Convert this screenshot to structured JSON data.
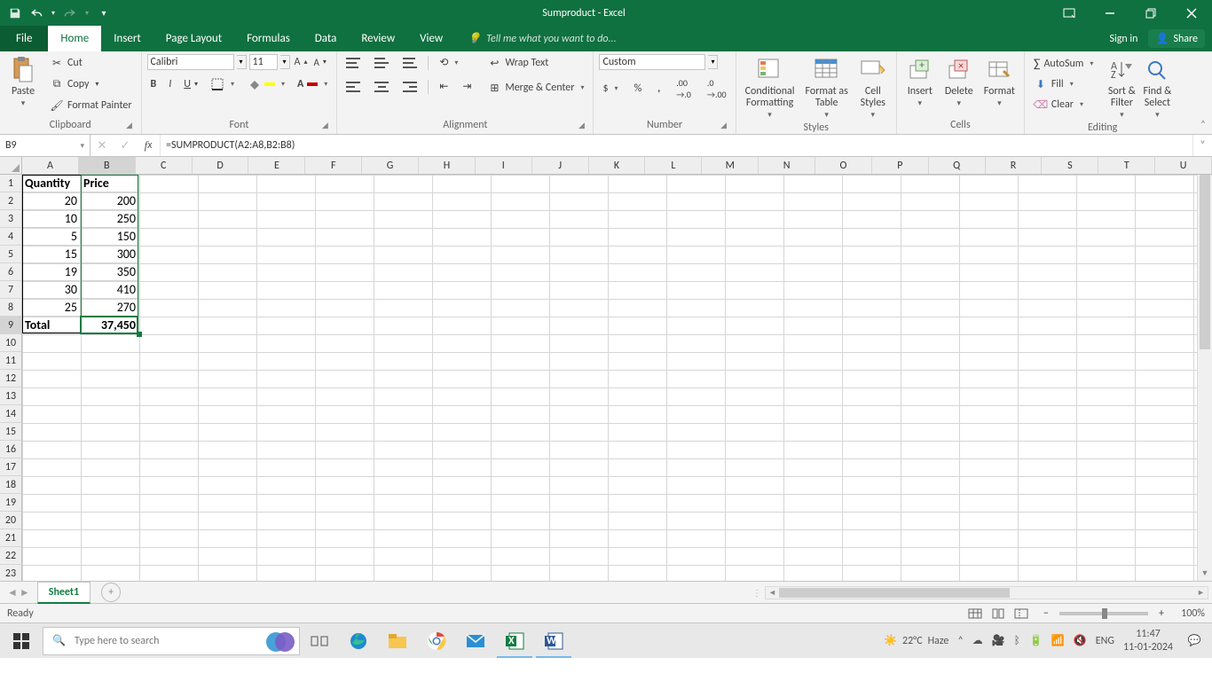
{
  "titlebar": {
    "document_title": "Sumproduct - Excel"
  },
  "tabs": {
    "file": "File",
    "items": [
      "Home",
      "Insert",
      "Page Layout",
      "Formulas",
      "Data",
      "Review",
      "View"
    ],
    "active": "Home",
    "tell_me": "Tell me what you want to do...",
    "sign_in": "Sign in",
    "share": "Share"
  },
  "ribbon": {
    "clipboard": {
      "label": "Clipboard",
      "paste": "Paste",
      "cut": "Cut",
      "copy": "Copy",
      "format_painter": "Format Painter"
    },
    "font": {
      "label": "Font",
      "name": "Calibri",
      "size": "11"
    },
    "alignment": {
      "label": "Alignment",
      "wrap": "Wrap Text",
      "merge": "Merge & Center"
    },
    "number": {
      "label": "Number",
      "format": "Custom"
    },
    "styles": {
      "label": "Styles",
      "conditional": "Conditional\nFormatting",
      "table": "Format as\nTable",
      "cell": "Cell\nStyles"
    },
    "cells": {
      "label": "Cells",
      "insert": "Insert",
      "delete": "Delete",
      "format": "Format"
    },
    "editing": {
      "label": "Editing",
      "autosum": "AutoSum",
      "fill": "Fill",
      "clear": "Clear",
      "sort": "Sort &\nFilter",
      "find": "Find &\nSelect"
    }
  },
  "namebox": "B9",
  "formula": "=SUMPRODUCT(A2:A8,B2:B8)",
  "columns": [
    "A",
    "B",
    "C",
    "D",
    "E",
    "F",
    "G",
    "H",
    "I",
    "J",
    "K",
    "L",
    "M",
    "N",
    "O",
    "P",
    "Q",
    "R",
    "S",
    "T",
    "U"
  ],
  "sheet": {
    "headers": {
      "A1": "Quantity",
      "B1": "Price"
    },
    "rows": [
      {
        "qty": "20",
        "price": "200"
      },
      {
        "qty": "10",
        "price": "250"
      },
      {
        "qty": "5",
        "price": "150"
      },
      {
        "qty": "15",
        "price": "300"
      },
      {
        "qty": "19",
        "price": "350"
      },
      {
        "qty": "30",
        "price": "410"
      },
      {
        "qty": "25",
        "price": "270"
      }
    ],
    "total_label": "Total",
    "total_value": "37,450"
  },
  "sheet_tab": "Sheet1",
  "status": {
    "ready": "Ready",
    "zoom": "100%"
  },
  "taskbar": {
    "search_placeholder": "Type here to search",
    "weather_temp": "22°C",
    "weather_desc": "Haze",
    "lang": "ENG",
    "time": "11:47",
    "date": "11-01-2024"
  }
}
